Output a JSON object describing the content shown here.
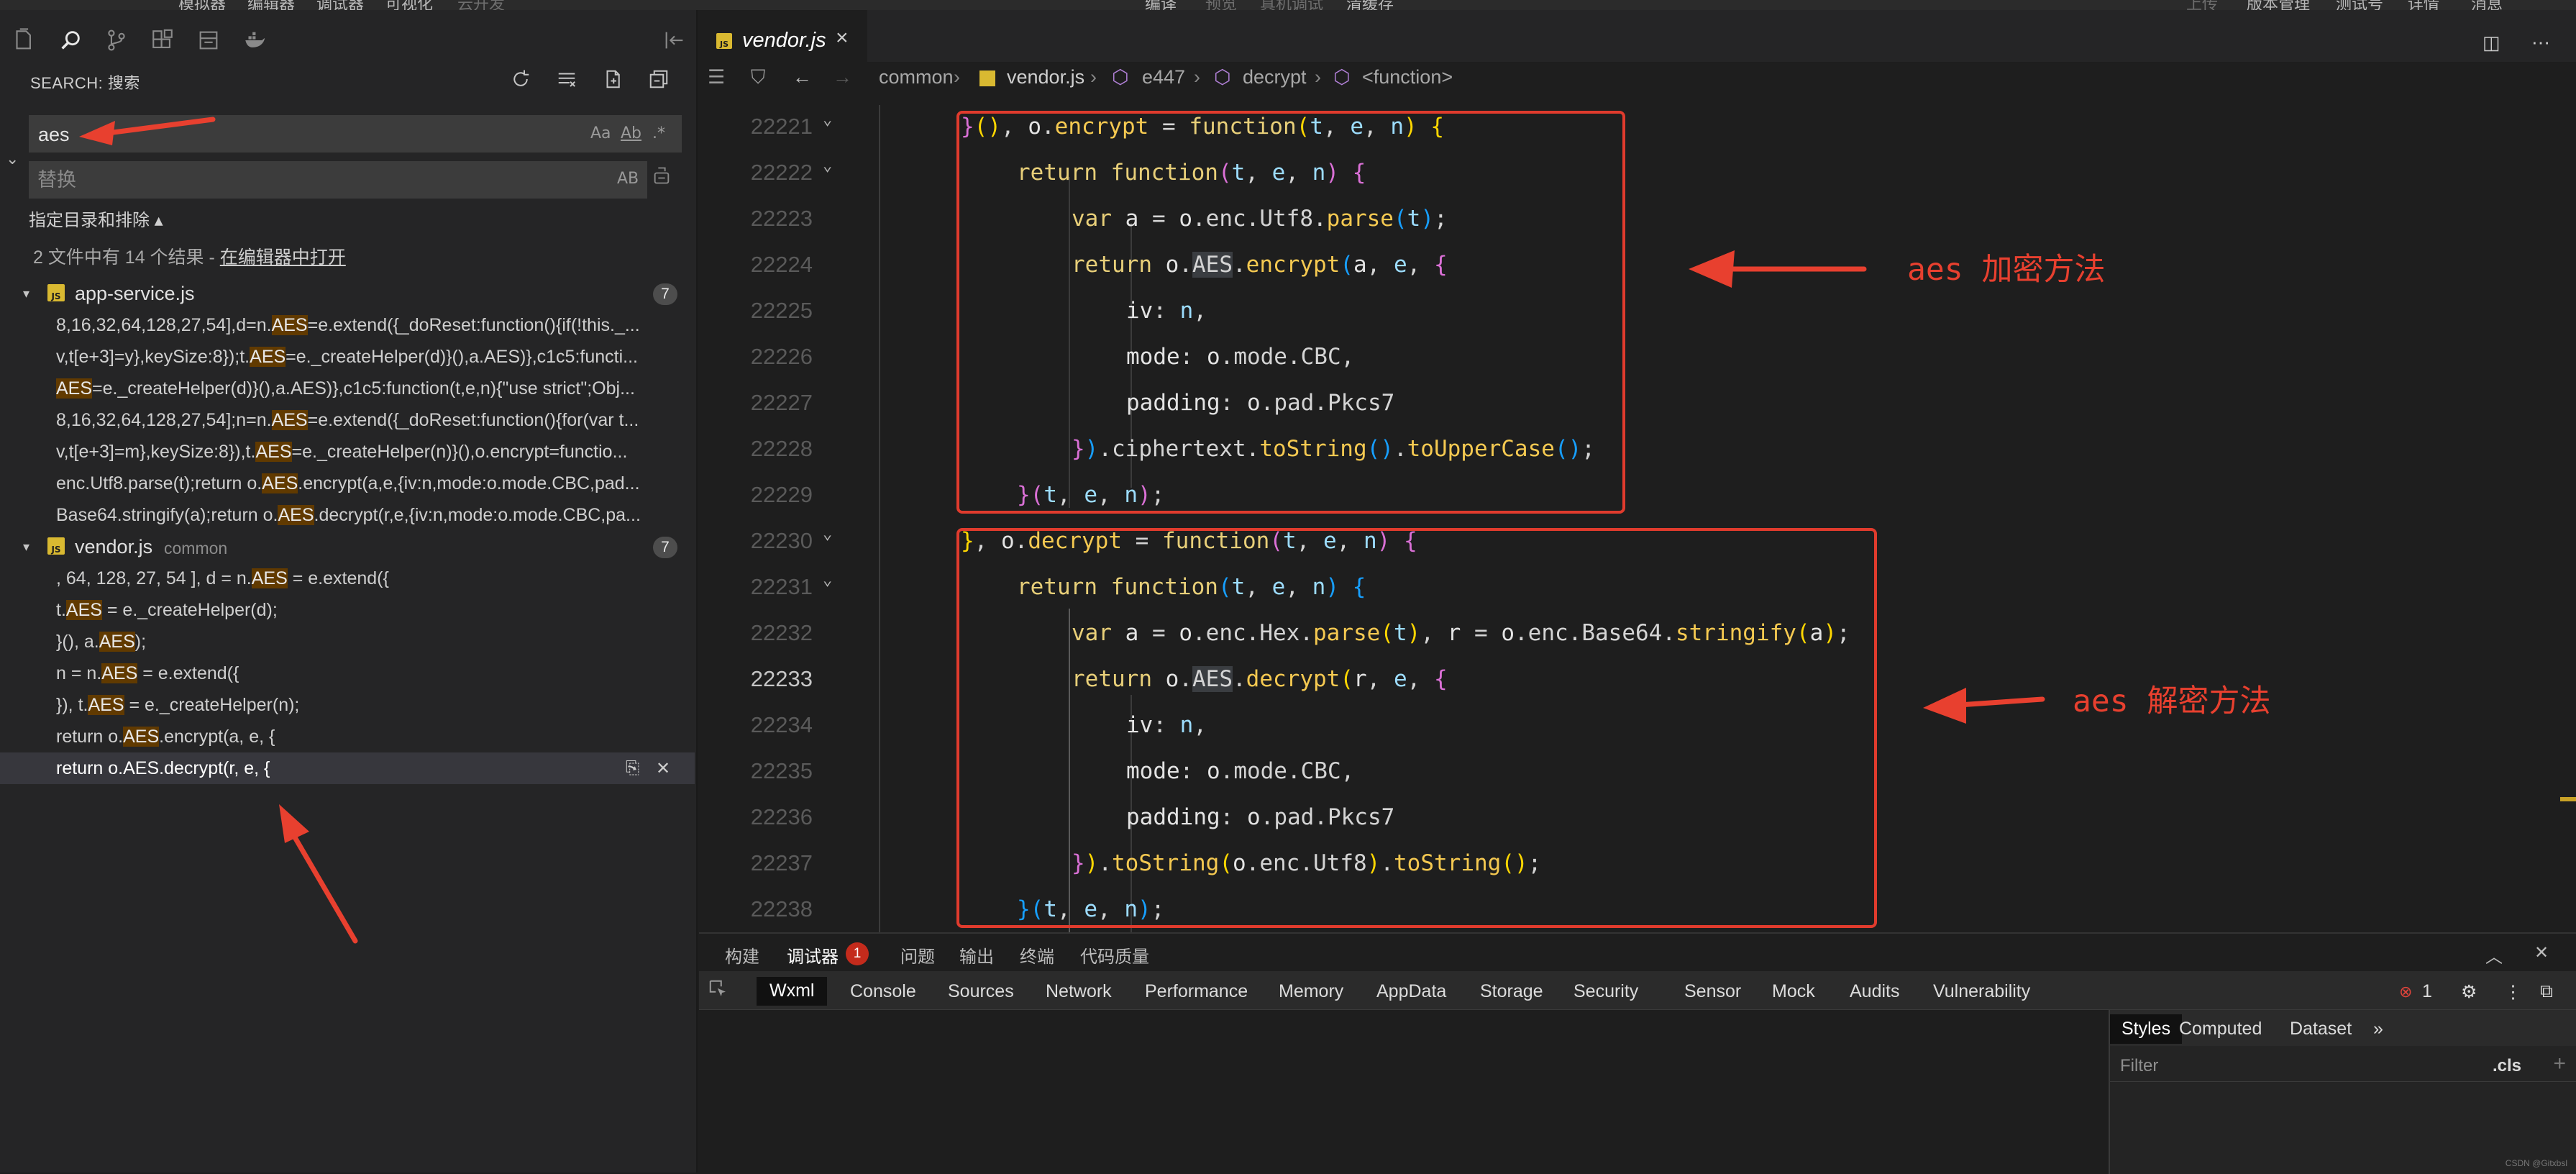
{
  "menubar": {
    "left_items": [
      "模拟器",
      "编辑器",
      "调试器",
      "可视化",
      "云开发"
    ],
    "center_items": [
      "编译",
      "预览",
      "真机调试",
      "清缓存"
    ],
    "right_items": [
      "上传",
      "版本管理",
      "测试号",
      "详情",
      "消息"
    ]
  },
  "sidebar": {
    "section_title": "SEARCH: 搜索",
    "search": {
      "value": "aes",
      "opt_case": "Aa",
      "opt_word": "Ab",
      "opt_regex": ".*"
    },
    "replace": {
      "placeholder": "替换",
      "opt_preserve": "AB"
    },
    "includes_label": "指定目录和排除 ▴",
    "summary_prefix": "2 文件中有 14 个结果 - ",
    "summary_link": "在编辑器中打开",
    "files": [
      {
        "name": "app-service.js",
        "dir": "",
        "count": "7",
        "matches": [
          {
            "pre": "8,16,32,64,128,27,54],d=n.",
            "hit": "AES",
            "post": "=e.extend({_doReset:function(){if(!this._..."
          },
          {
            "pre": "v,t[e+3]=y},keySize:8});t.",
            "hit": "AES",
            "post": "=e._createHelper(d)}(),a.AES)},c1c5:functi..."
          },
          {
            "pre": "",
            "hit": "AES",
            "post": "=e._createHelper(d)}(),a.AES)},c1c5:function(t,e,n){\"use strict\";Obj..."
          },
          {
            "pre": "8,16,32,64,128,27,54];n=n.",
            "hit": "AES",
            "post": "=e.extend({_doReset:function(){for(var t..."
          },
          {
            "pre": "v,t[e+3]=m},keySize:8}),t.",
            "hit": "AES",
            "post": "=e._createHelper(n)}(),o.encrypt=functio..."
          },
          {
            "pre": "enc.Utf8.parse(t);return o.",
            "hit": "AES",
            "post": ".encrypt(a,e,{iv:n,mode:o.mode.CBC,pad..."
          },
          {
            "pre": "Base64.stringify(a);return o.",
            "hit": "AES",
            "post": ".decrypt(r,e,{iv:n,mode:o.mode.CBC,pa..."
          }
        ]
      },
      {
        "name": "vendor.js",
        "dir": "common",
        "count": "7",
        "matches": [
          {
            "pre": ", 64, 128, 27, 54 ], d = n.",
            "hit": "AES",
            "post": " = e.extend({"
          },
          {
            "pre": "t.",
            "hit": "AES",
            "post": " = e._createHelper(d);"
          },
          {
            "pre": "}(), a.",
            "hit": "AES",
            "post": ");"
          },
          {
            "pre": "n = n.",
            "hit": "AES",
            "post": " = e.extend({"
          },
          {
            "pre": "}), t.",
            "hit": "AES",
            "post": " = e._createHelper(n);"
          },
          {
            "pre": "return o.",
            "hit": "AES",
            "post": ".encrypt(a, e, {"
          },
          {
            "pre": "return o.AES.decrypt(r, e, {",
            "hit": "",
            "post": ""
          }
        ]
      }
    ]
  },
  "editor": {
    "tab_label": "vendor.js",
    "breadcrumb": [
      "common",
      "vendor.js",
      "e447",
      "decrypt",
      "<function>"
    ],
    "line_numbers": [
      "22221",
      "22222",
      "22223",
      "22224",
      "22225",
      "22226",
      "22227",
      "22228",
      "22229",
      "22230",
      "22231",
      "22232",
      "22233",
      "22234",
      "22235",
      "22236",
      "22237",
      "22238"
    ],
    "current_line": "22233",
    "annotation_encrypt": "aes 加密方法",
    "annotation_decrypt": "aes 解密方法"
  },
  "panel": {
    "tabs": [
      "构建",
      "调试器",
      "问题",
      "输出",
      "终端",
      "代码质量"
    ],
    "debugger_badge": "1",
    "devtools_tabs": [
      "Wxml",
      "Console",
      "Sources",
      "Network",
      "Performance",
      "Memory",
      "AppData",
      "Storage",
      "Security",
      "Sensor",
      "Mock",
      "Audits",
      "Vulnerability"
    ],
    "error_count": "1",
    "styles_tabs": [
      "Styles",
      "Computed",
      "Dataset",
      "»"
    ],
    "filter_placeholder": "Filter",
    "cls_label": ".cls",
    "add_label": "+"
  },
  "watermark": "CSDN @Gitxbsl"
}
